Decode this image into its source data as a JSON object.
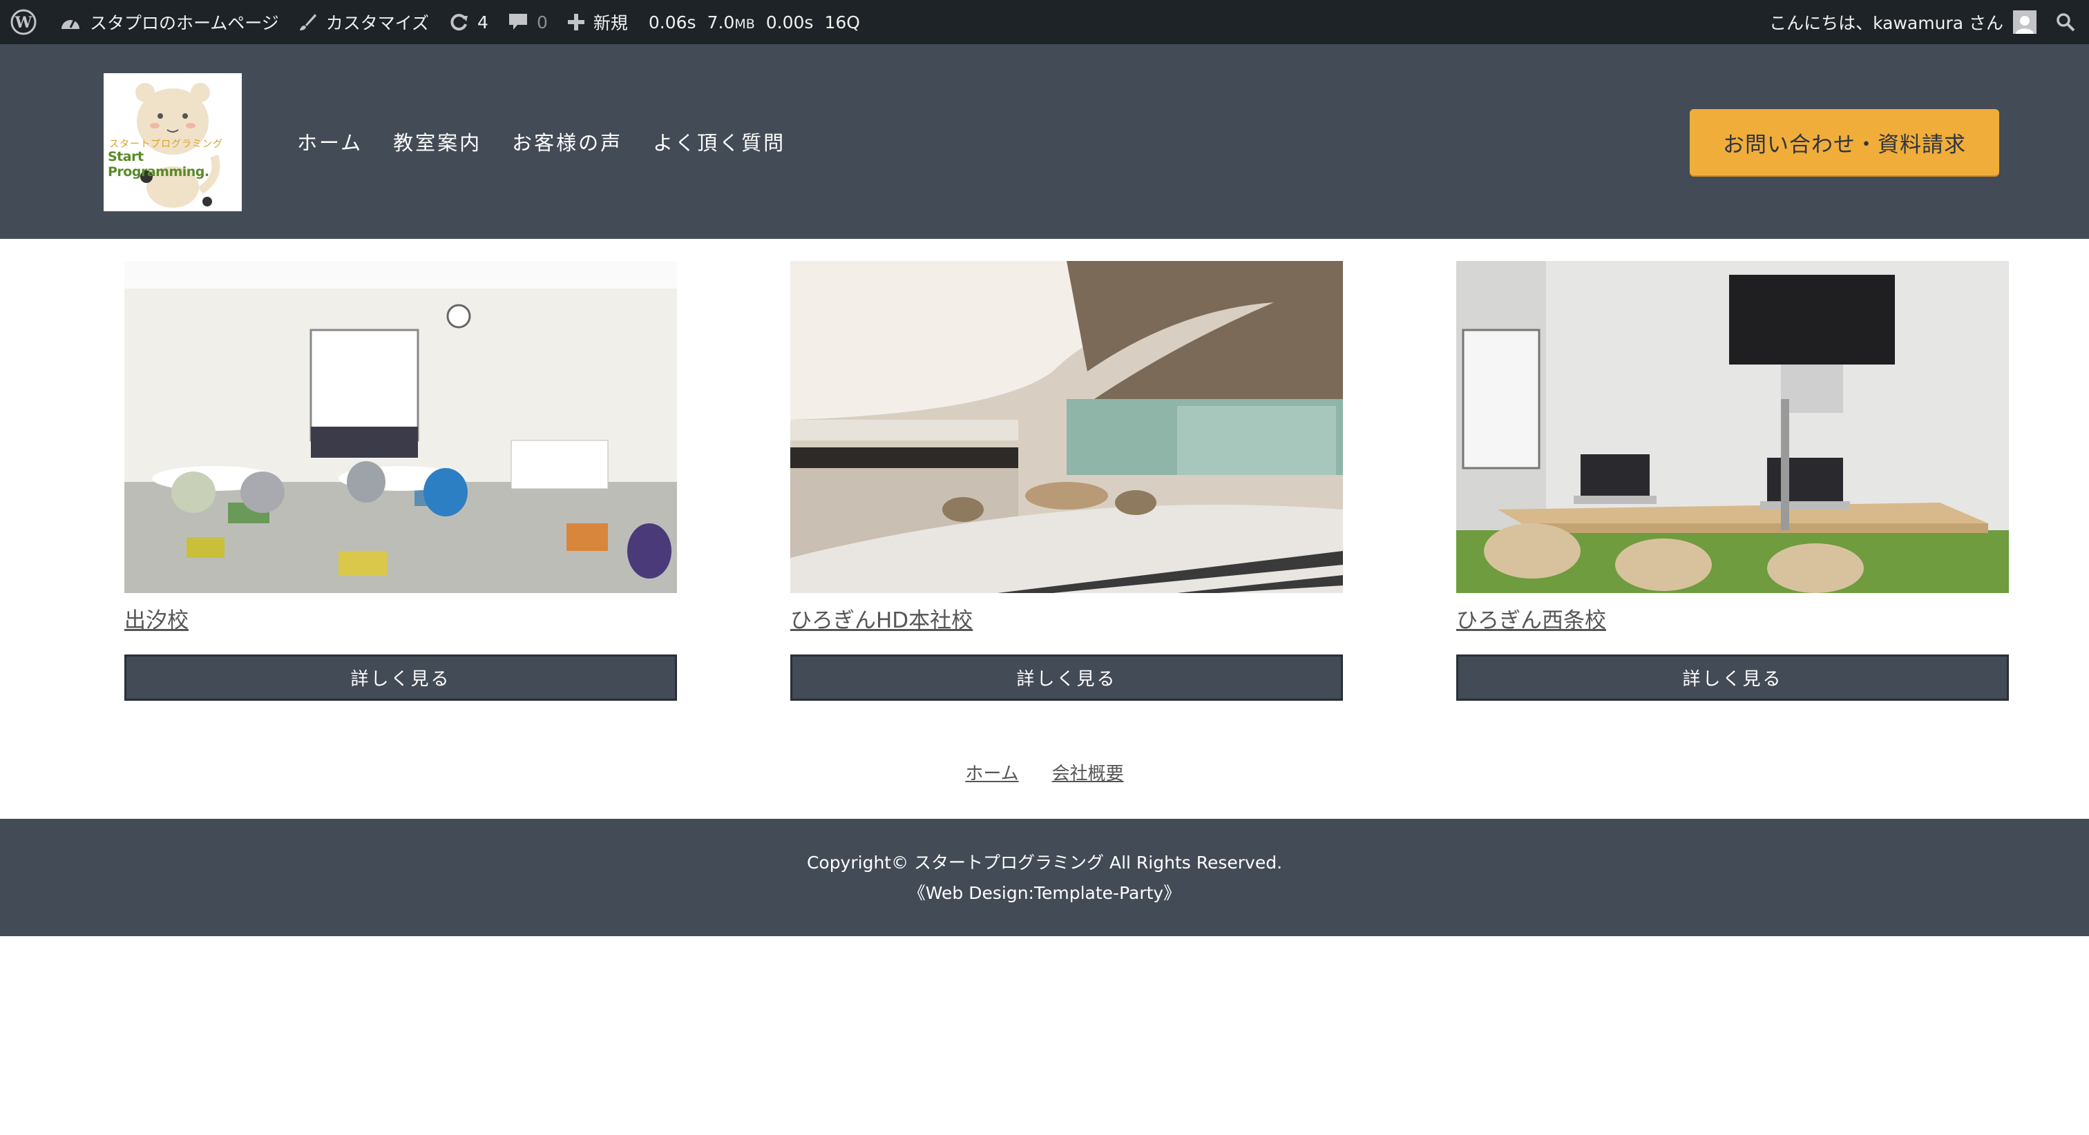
{
  "admin_bar": {
    "site_name": "スタプロのホームページ",
    "customize": "カスタマイズ",
    "updates_count": "4",
    "comments_count": "0",
    "new_label": "新規",
    "qm_time": "0.06s",
    "qm_memory": "7.0",
    "qm_memory_unit": "MB",
    "qm_db_time": "0.00s",
    "qm_queries": "16Q",
    "greeting": "こんにちは、kawamura さん"
  },
  "header": {
    "logo_jp": "スタートプログラミング",
    "logo_en": "Start Programming.",
    "nav": [
      "ホーム",
      "教室案内",
      "お客様の声",
      "よく頂く質問"
    ],
    "cta_label": "お問い合わせ・資料請求"
  },
  "cards": [
    {
      "title": "出汐校",
      "button": "詳しく見る"
    },
    {
      "title": "ひろぎんHD本社校",
      "button": "詳しく見る"
    },
    {
      "title": "ひろぎん西条校",
      "button": "詳しく見る"
    }
  ],
  "footer_menu": [
    "ホーム",
    "会社概要"
  ],
  "footer": {
    "copyright": "Copyright© スタートプログラミング All Rights Reserved.",
    "credit": "《Web Design:Template-Party》"
  },
  "colors": {
    "admin_bar_bg": "#1d2327",
    "header_bg": "#434b56",
    "cta_bg": "#f0ad3a",
    "footer_bg": "#434b56"
  }
}
